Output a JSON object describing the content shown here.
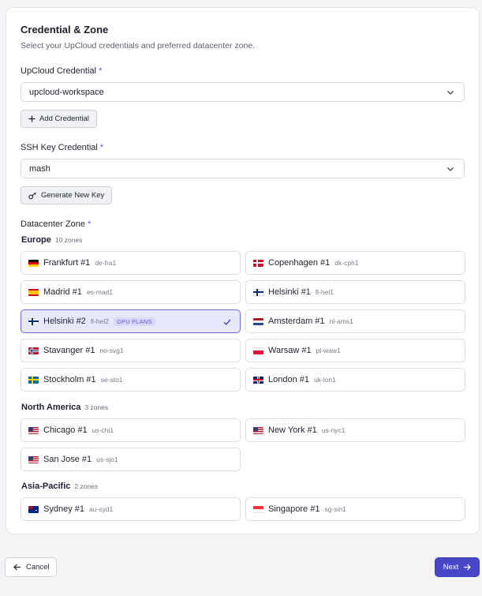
{
  "section": {
    "title": "Credential & Zone",
    "subtitle": "Select your UpCloud credentials and preferred datacenter zone."
  },
  "upcloud_credential": {
    "label": "UpCloud Credential",
    "required_mark": "*",
    "value": "upcloud-workspace",
    "add_button": "Add Credential"
  },
  "ssh_credential": {
    "label": "SSH Key Credential",
    "required_mark": "*",
    "value": "mash",
    "generate_button": "Generate New Key"
  },
  "datacenter": {
    "label": "Datacenter Zone",
    "required_mark": "*",
    "regions": [
      {
        "name": "Europe",
        "count": "10 zones",
        "zones": [
          {
            "name": "Frankfurt #1",
            "code": "de-fra1",
            "flag": "de"
          },
          {
            "name": "Copenhagen #1",
            "code": "dk-cph1",
            "flag": "dk"
          },
          {
            "name": "Madrid #1",
            "code": "es-mad1",
            "flag": "es"
          },
          {
            "name": "Helsinki #1",
            "code": "fi-hel1",
            "flag": "fi"
          },
          {
            "name": "Helsinki #2",
            "code": "fi-hel2",
            "flag": "fi",
            "badge": "GPU PLANS",
            "selected": true
          },
          {
            "name": "Amsterdam #1",
            "code": "nl-ams1",
            "flag": "nl"
          },
          {
            "name": "Stavanger #1",
            "code": "no-svg1",
            "flag": "no"
          },
          {
            "name": "Warsaw #1",
            "code": "pl-waw1",
            "flag": "pl"
          },
          {
            "name": "Stockholm #1",
            "code": "se-sto1",
            "flag": "se"
          },
          {
            "name": "London #1",
            "code": "uk-lon1",
            "flag": "uk"
          }
        ]
      },
      {
        "name": "North America",
        "count": "3 zones",
        "zones": [
          {
            "name": "Chicago #1",
            "code": "us-chi1",
            "flag": "us"
          },
          {
            "name": "New York #1",
            "code": "us-nyc1",
            "flag": "us"
          },
          {
            "name": "San Jose #1",
            "code": "us-sjo1",
            "flag": "us"
          }
        ]
      },
      {
        "name": "Asia-Pacific",
        "count": "2 zones",
        "zones": [
          {
            "name": "Sydney #1",
            "code": "au-syd1",
            "flag": "au"
          },
          {
            "name": "Singapore #1",
            "code": "sg-sin1",
            "flag": "sg"
          }
        ]
      }
    ]
  },
  "footer": {
    "cancel_label": "Cancel",
    "next_label": "Next"
  },
  "colors": {
    "accent": "#4747c7",
    "selected_bg": "#e8e8fb",
    "selected_border": "#6b6bd9"
  }
}
